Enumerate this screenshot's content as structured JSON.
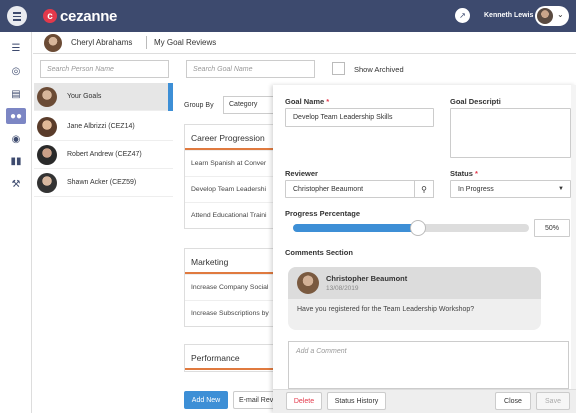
{
  "app": {
    "brand": "cezanne",
    "user_name": "Kenneth Lewis"
  },
  "icons": {
    "menu": "hamburger-icon",
    "external": "external-link-icon",
    "chevron": "chevron-down-icon"
  },
  "sidebar": {
    "items": [
      "list-icon",
      "target-icon",
      "calendar-icon",
      "people-icon",
      "chat-icon",
      "chart-icon",
      "wrench-icon"
    ],
    "active": "people-icon"
  },
  "subheader": {
    "person": "Cheryl Abrahams",
    "title": "My Goal Reviews"
  },
  "filters": {
    "search_person_placeholder": "Search Person Name",
    "search_goal_placeholder": "Search Goal Name",
    "show_archived_label": "Show Archived"
  },
  "people": [
    {
      "name": "Your Goals"
    },
    {
      "name": "Jane Albrizzi (CEZ14)"
    },
    {
      "name": "Robert Andrew (CEZ47)"
    },
    {
      "name": "Shawn Acker (CEZ59)"
    }
  ],
  "groupby": {
    "label": "Group By",
    "value": "Category"
  },
  "categories": [
    {
      "title": "Career Progression",
      "items": [
        "Learn Spanish at Conver",
        "Develop Team Leadershi",
        "Attend Educational Traini"
      ]
    },
    {
      "title": "Marketing",
      "items": [
        "Increase Company Social",
        "Increase Subscriptions by"
      ]
    },
    {
      "title": "Performance",
      "items": []
    }
  ],
  "list_buttons": {
    "add_new": "Add New",
    "email": "E-mail Revi"
  },
  "form": {
    "goal_name_label": "Goal Name",
    "goal_name_value": "Develop Team Leadership Skills",
    "description_label": "Goal Descripti",
    "reviewer_label": "Reviewer",
    "reviewer_value": "Christopher Beaumont",
    "status_label": "Status",
    "status_value": "In Progress",
    "progress_label": "Progress Percentage",
    "progress_value": 50,
    "progress_text": "50%",
    "required_mark": "*"
  },
  "comments": {
    "section_label": "Comments Section",
    "items": [
      {
        "author": "Christopher Beaumont",
        "date": "13/08/2019",
        "text": "Have you registered for the Team Leadership Workshop?"
      }
    ],
    "add_placeholder": "Add a Comment"
  },
  "footer": {
    "delete": "Delete",
    "history": "Status History",
    "close": "Close",
    "save": "Save"
  },
  "colors": {
    "topbar": "#3d4a6e",
    "accent": "#3d8fd6",
    "danger": "#e3394b",
    "category_underline": "#e07a3f",
    "sidebar_active": "#7c86c4"
  }
}
